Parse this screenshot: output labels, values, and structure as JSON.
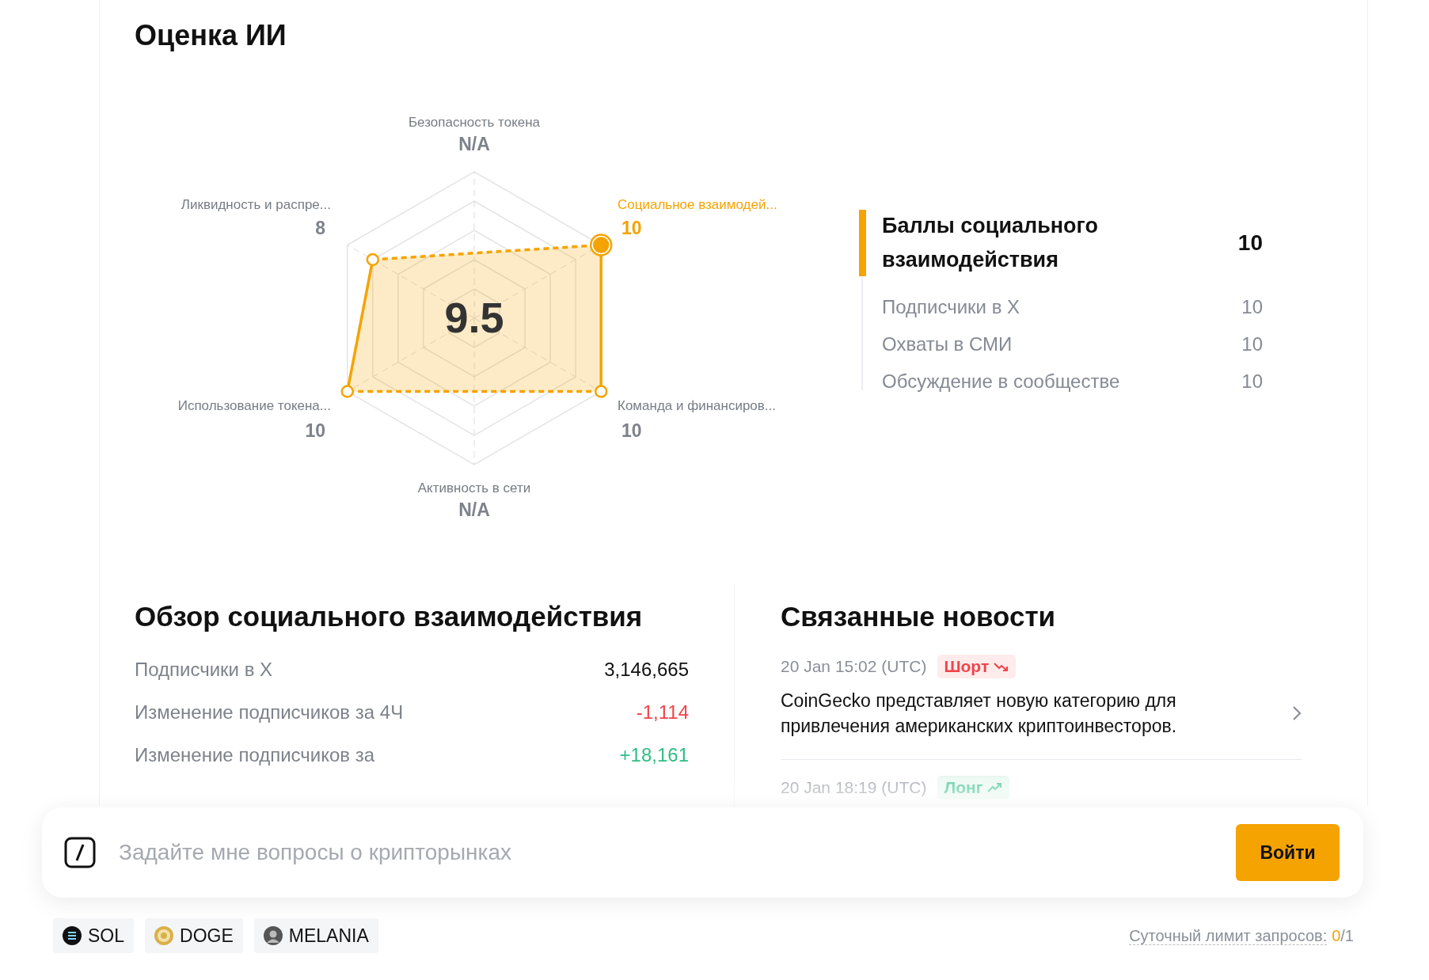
{
  "title": "Оценка ИИ",
  "radar": {
    "overall": "9.5",
    "axes": [
      {
        "label": "Безопасность токена",
        "score": "N/A",
        "selected": false
      },
      {
        "label": "Ликвидность и распре...",
        "score": "8",
        "selected": false
      },
      {
        "label": "Социальное взаимодей...",
        "score": "10",
        "selected": true
      },
      {
        "label": "Использование токена...",
        "score": "10",
        "selected": false
      },
      {
        "label": "Команда и финансиров...",
        "score": "10",
        "selected": false
      },
      {
        "label": "Активность в сети",
        "score": "N/A",
        "selected": false
      }
    ]
  },
  "score_breakdown": {
    "title": "Баллы социального взаимодействия",
    "score": "10",
    "items": [
      {
        "label": "Подписчики в X",
        "score": "10"
      },
      {
        "label": "Охваты в СМИ",
        "score": "10"
      },
      {
        "label": "Обсуждение в сообществе",
        "score": "10"
      }
    ]
  },
  "social_overview": {
    "title": "Обзор социального взаимодействия",
    "rows": [
      {
        "label": "Подписчики в X",
        "value": "3,146,665",
        "color": "#111111"
      },
      {
        "label": "Изменение подписчиков за 4Ч",
        "value": "-1,114",
        "color": "#f0434a"
      },
      {
        "label": "Изменение подписчиков за",
        "value": "+18,161",
        "color": "#2ebd85"
      }
    ]
  },
  "related_news": {
    "title": "Связанные новости",
    "items": [
      {
        "time": "20 Jan 15:02 (UTC)",
        "signal": {
          "label": "Шорт",
          "kind": "short"
        },
        "headline": "CoinGecko представляет новую категорию для привлечения американских криптоинвесторов."
      },
      {
        "time": "20 Jan 18:19 (UTC)",
        "signal": {
          "label": "Лонг",
          "kind": "long"
        }
      }
    ]
  },
  "chat": {
    "placeholder": "Задайте мне вопросы о крипторынках",
    "button": "Войти"
  },
  "coins": [
    {
      "symbol": "SOL",
      "kind": "sol"
    },
    {
      "symbol": "DOGE",
      "kind": "doge"
    },
    {
      "symbol": "MELANIA",
      "kind": "melania"
    }
  ],
  "daily_limit": {
    "label": "Суточный лимит запросов:",
    "used": "0",
    "total": "/1"
  }
}
